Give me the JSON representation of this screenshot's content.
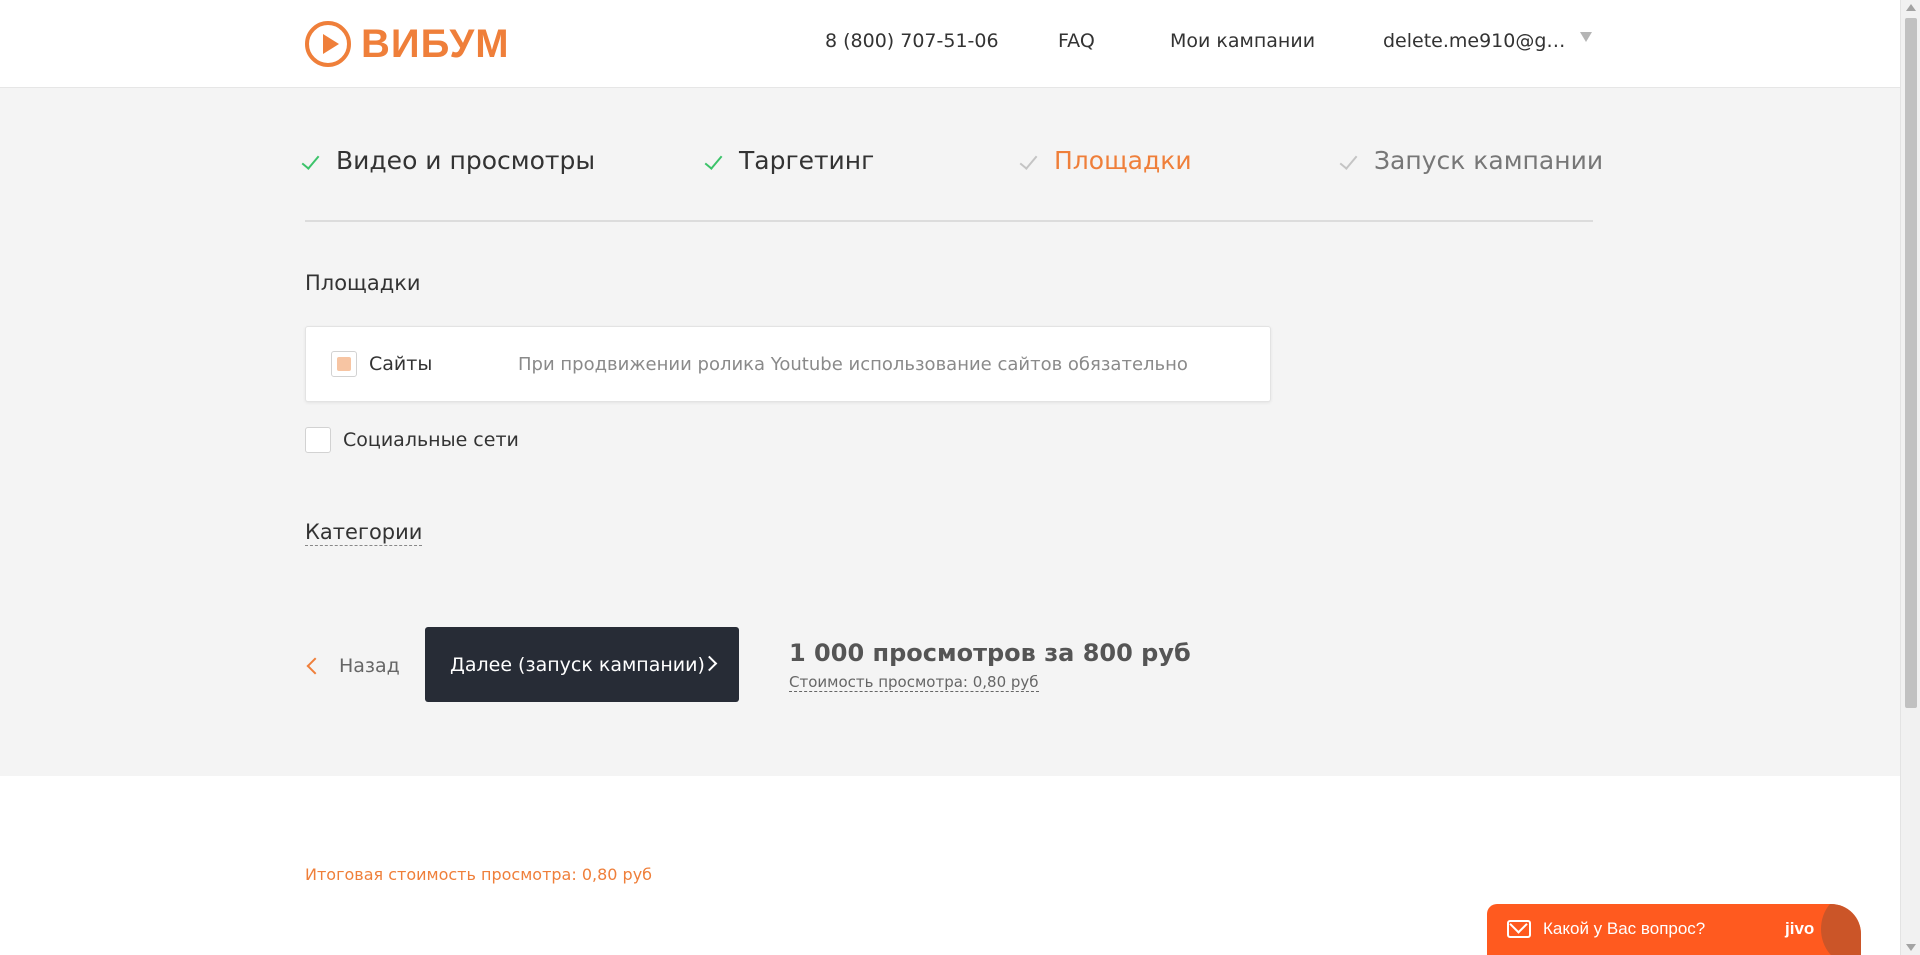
{
  "header": {
    "logo_text": "ВИБУМ",
    "phone": "8 (800) 707-51-06",
    "faq": "FAQ",
    "my_campaigns": "Мои кампании",
    "user_email": "delete.me910@gm..."
  },
  "steps": [
    {
      "label": "Видео и просмотры",
      "state": "done"
    },
    {
      "label": "Таргетинг",
      "state": "done"
    },
    {
      "label": "Площадки",
      "state": "active"
    },
    {
      "label": "Запуск кампании",
      "state": "pending"
    }
  ],
  "platforms": {
    "title": "Площадки",
    "sites": {
      "label": "Сайты",
      "checked": true,
      "note": "При продвижении ролика Youtube использование сайтов обязательно"
    },
    "social": {
      "label": "Социальные сети",
      "checked": false
    }
  },
  "categories": {
    "title": "Категории"
  },
  "actions": {
    "back_label": "Назад",
    "next_label": "Далее (запуск кампании)"
  },
  "pricing": {
    "summary": "1 000 просмотров за 800 руб",
    "per_view": "Стоимость просмотра: 0,80 руб",
    "total": "Итоговая стоимость просмотра: 0,80 руб"
  },
  "chat": {
    "label": "Какой у Вас вопрос?",
    "brand": "jivo"
  },
  "colors": {
    "accent": "#ef7f3a",
    "check_done": "#3cc36a",
    "button_dark": "#272c36",
    "chat": "#ff5a1f"
  }
}
